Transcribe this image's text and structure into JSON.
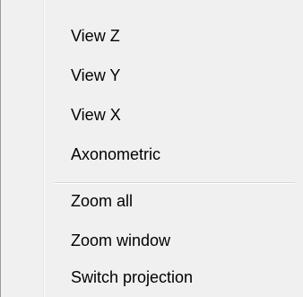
{
  "context_menu": {
    "items": [
      {
        "label": "View Z"
      },
      {
        "label": "View Y"
      },
      {
        "label": "View X"
      },
      {
        "label": "Axonometric"
      },
      {
        "label": "Zoom all"
      },
      {
        "label": "Zoom window"
      },
      {
        "label": "Switch projection"
      }
    ]
  }
}
